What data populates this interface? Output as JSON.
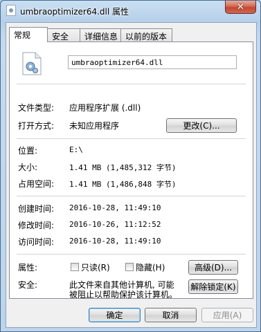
{
  "window": {
    "title": "umbraoptimizer64.dll 属性",
    "close_glyph": "✕"
  },
  "tabs": [
    {
      "label": "常规",
      "active": true
    },
    {
      "label": "安全",
      "active": false
    },
    {
      "label": "详细信息",
      "active": false
    },
    {
      "label": "以前的版本",
      "active": false
    }
  ],
  "general": {
    "file_name": "umbraoptimizer64.dll",
    "file_type_label": "文件类型:",
    "file_type_value": "应用程序扩展 (.dll)",
    "opens_with_label": "打开方式:",
    "opens_with_value": "未知应用程序",
    "change_button": "更改(C)...",
    "location_label": "位置:",
    "location_value": "E:\\",
    "size_label": "大小:",
    "size_value": "1.41 MB (1,485,312 字节)",
    "size_on_disk_label": "占用空间:",
    "size_on_disk_value": "1.41 MB (1,486,848 字节)",
    "created_label": "创建时间:",
    "created_value": "2016-10-28, 11:49:10",
    "modified_label": "修改时间:",
    "modified_value": "2016-10-26, 11:12:52",
    "accessed_label": "访问时间:",
    "accessed_value": "2016-10-28, 11:49:10",
    "attributes_label": "属性:",
    "readonly_label": "只读(R)",
    "hidden_label": "隐藏(H)",
    "advanced_button": "高级(D)...",
    "security_label": "安全:",
    "security_text_line1": "此文件来自其他计算机, 可能",
    "security_text_line2": "被阻止以帮助保护该计算机。",
    "unblock_button": "解除锁定(K)"
  },
  "footer": {
    "ok_button": "确定",
    "cancel_button": "取消",
    "apply_button": "应用(A)"
  },
  "colors": {
    "title_bar": "#bcd4ec",
    "close_button": "#c24731",
    "dialog_bg": "#f0f0f0"
  }
}
